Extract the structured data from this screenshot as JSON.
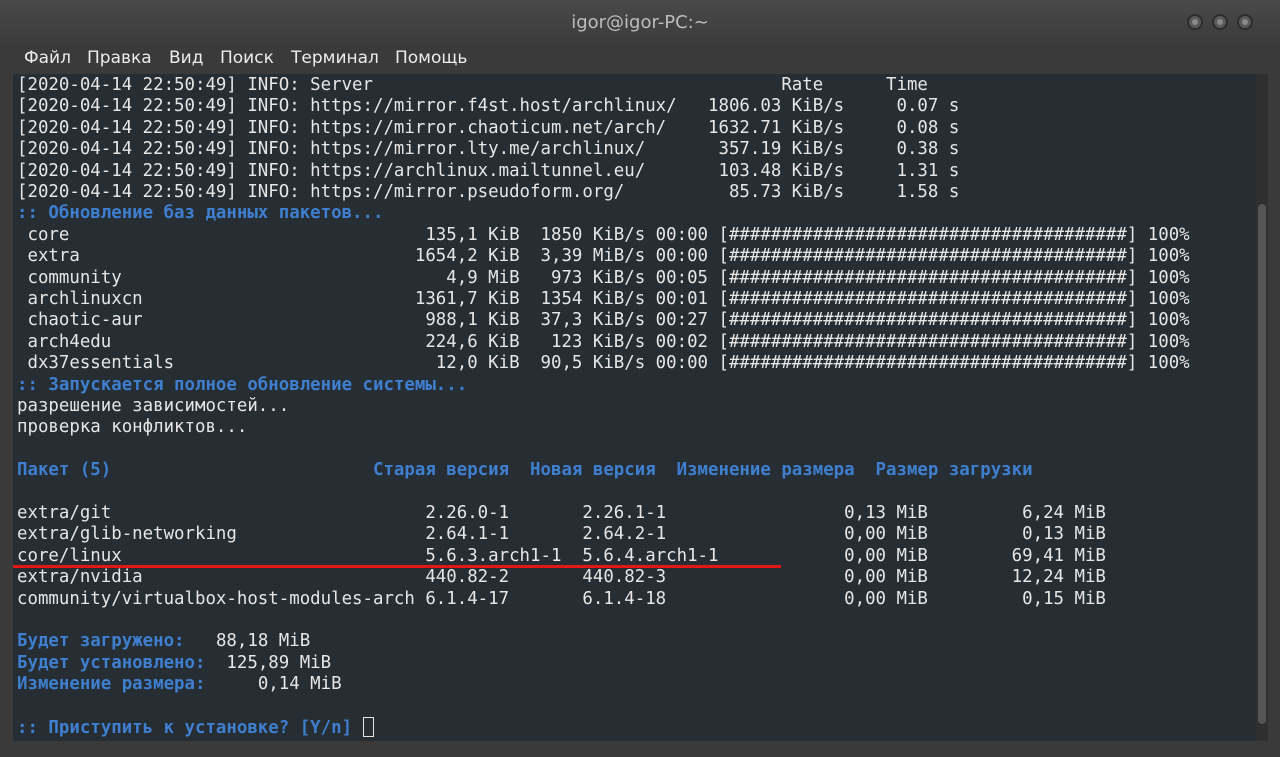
{
  "window": {
    "title": "igor@igor-PC:~"
  },
  "menu": {
    "items": [
      "Файл",
      "Правка",
      "Вид",
      "Поиск",
      "Терминал",
      "Помощь"
    ]
  },
  "terminal": {
    "lines": [
      {
        "text": "[2020-04-14 22:50:49] INFO: Server                                       Rate      Time",
        "style": "plain"
      },
      {
        "text": "[2020-04-14 22:50:49] INFO: https://mirror.f4st.host/archlinux/   1806.03 KiB/s     0.07 s",
        "style": "plain"
      },
      {
        "text": "[2020-04-14 22:50:49] INFO: https://mirror.chaoticum.net/arch/    1632.71 KiB/s     0.08 s",
        "style": "plain"
      },
      {
        "text": "[2020-04-14 22:50:49] INFO: https://mirror.lty.me/archlinux/       357.19 KiB/s     0.38 s",
        "style": "plain"
      },
      {
        "text": "[2020-04-14 22:50:49] INFO: https://archlinux.mailtunnel.eu/       103.48 KiB/s     1.31 s",
        "style": "plain"
      },
      {
        "text": "[2020-04-14 22:50:49] INFO: https://mirror.pseudoform.org/          85.73 KiB/s     1.58 s",
        "style": "plain"
      },
      {
        "text": ":: Обновление баз данных пакетов...",
        "style": "blue"
      },
      {
        "text": " core                                  135,1 KiB  1850 KiB/s 00:00 [######################################] 100%",
        "style": "plain"
      },
      {
        "text": " extra                                1654,2 KiB  3,39 MiB/s 00:00 [######################################] 100%",
        "style": "plain"
      },
      {
        "text": " community                               4,9 MiB   973 KiB/s 00:05 [######################################] 100%",
        "style": "plain"
      },
      {
        "text": " archlinuxcn                          1361,7 KiB  1354 KiB/s 00:01 [######################################] 100%",
        "style": "plain"
      },
      {
        "text": " chaotic-aur                           988,1 KiB  37,3 KiB/s 00:27 [######################################] 100%",
        "style": "plain"
      },
      {
        "text": " arch4edu                              224,6 KiB   123 KiB/s 00:02 [######################################] 100%",
        "style": "plain"
      },
      {
        "text": " dx37essentials                         12,0 KiB  90,5 KiB/s 00:00 [######################################] 100%",
        "style": "plain"
      },
      {
        "text": ":: Запускается полное обновление системы...",
        "style": "blue"
      },
      {
        "text": "разрешение зависимостей...",
        "style": "plain"
      },
      {
        "text": "проверка конфликтов...",
        "style": "plain"
      },
      {
        "text": "",
        "style": "plain"
      },
      {
        "text": "Пакет (5)                         Старая версия  Новая версия  Изменение размера  Размер загрузки",
        "style": "blue"
      },
      {
        "text": "",
        "style": "plain"
      },
      {
        "text": "extra/git                              2.26.0-1       2.26.1-1                 0,13 MiB         6,24 MiB",
        "style": "plain"
      },
      {
        "text": "extra/glib-networking                  2.64.1-1       2.64.2-1                 0,00 MiB         0,13 MiB",
        "style": "plain"
      },
      {
        "text": "core/linux                             5.6.3.arch1-1  5.6.4.arch1-1            0,00 MiB        69,41 MiB",
        "style": "plain"
      },
      {
        "text": "extra/nvidia                           440.82-2       440.82-3                 0,00 MiB        12,24 MiB",
        "style": "plain"
      },
      {
        "text": "community/virtualbox-host-modules-arch 6.1.4-17       6.1.4-18                 0,00 MiB         0,15 MiB",
        "style": "plain"
      },
      {
        "text": "",
        "style": "plain"
      },
      {
        "text": "Будет загружено:   88,18 MiB",
        "style": "mixed",
        "label": "Будет загружено:",
        "value": "   88,18 MiB"
      },
      {
        "text": "Будет установлено:  125,89 MiB",
        "style": "mixed",
        "label": "Будет установлено:",
        "value": "  125,89 MiB"
      },
      {
        "text": "Изменение размера:     0,14 MiB",
        "style": "mixed",
        "label": "Изменение размера:",
        "value": "     0,14 MiB"
      },
      {
        "text": "",
        "style": "plain"
      },
      {
        "text": ":: Приступить к установке? [Y/n] ",
        "style": "prompt"
      }
    ]
  },
  "colors": {
    "terminal_bg": "#262d33",
    "text": "#e6e6e6",
    "accent_blue": "#3f7fd0",
    "highlight_red": "#e01818"
  }
}
